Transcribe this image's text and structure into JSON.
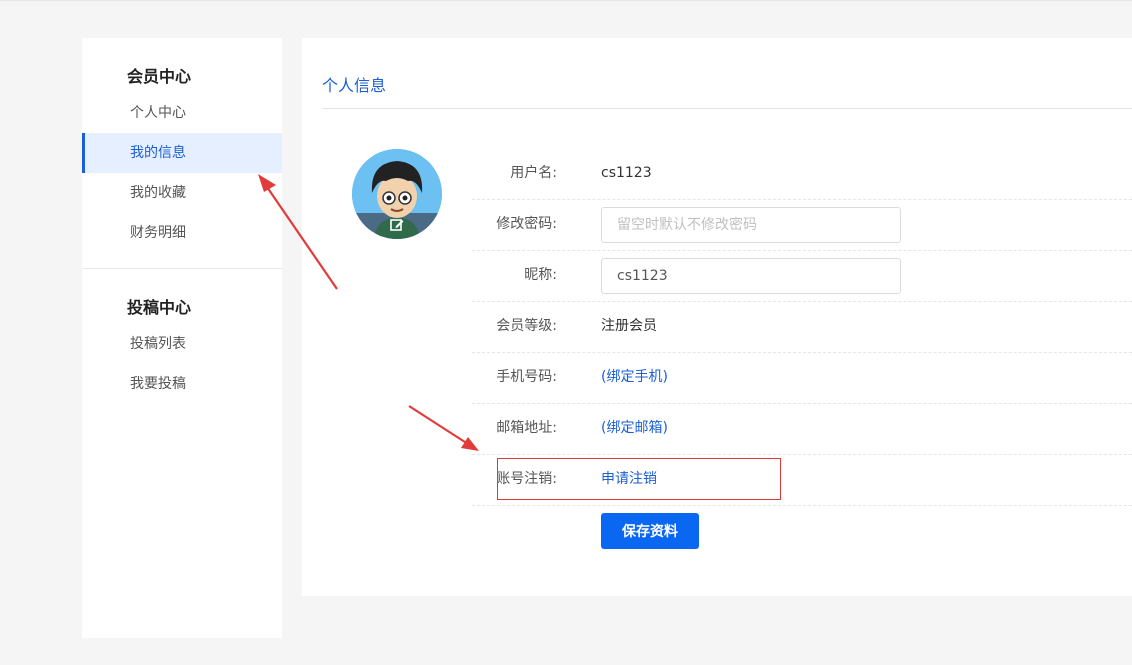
{
  "sidebar": {
    "groups": [
      {
        "title": "会员中心",
        "items": [
          "个人中心",
          "我的信息",
          "我的收藏",
          "财务明细"
        ]
      },
      {
        "title": "投稿中心",
        "items": [
          "投稿列表",
          "我要投稿"
        ]
      }
    ],
    "active_item": "我的信息"
  },
  "main": {
    "section_title": "个人信息",
    "fields": {
      "username": {
        "label": "用户名:",
        "value": "cs1123"
      },
      "password": {
        "label": "修改密码:",
        "placeholder": "留空时默认不修改密码",
        "value": ""
      },
      "nickname": {
        "label": "昵称:",
        "value": "cs1123"
      },
      "level": {
        "label": "会员等级:",
        "value": "注册会员"
      },
      "phone": {
        "label": "手机号码:",
        "link": "(绑定手机)"
      },
      "email": {
        "label": "邮箱地址:",
        "link": "(绑定邮箱)"
      },
      "cancel_account": {
        "label": "账号注销:",
        "link": "申请注销"
      }
    },
    "save_label": "保存资料"
  },
  "colors": {
    "accent": "#1a5fd6",
    "primary_button": "#0a67f2",
    "annotation_red": "#e23b3b",
    "page_bg": "#f5f5f5"
  },
  "icons": {
    "avatar_edit": "edit-icon"
  }
}
